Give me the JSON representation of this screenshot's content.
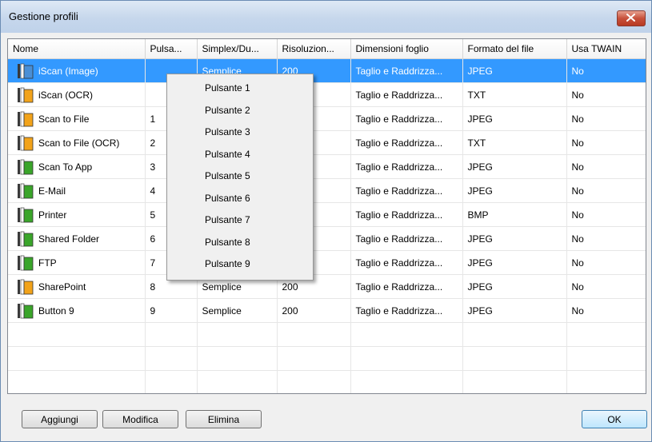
{
  "window": {
    "title": "Gestione profili"
  },
  "columns": [
    "Nome",
    "Pulsa...",
    "Simplex/Du...",
    "Risoluzion...",
    "Dimensioni foglio",
    "Formato del file",
    "Usa TWAIN"
  ],
  "rows": [
    {
      "icon": "blue",
      "name": "iScan (Image)",
      "button": "",
      "mode": "Semplice",
      "res": "200",
      "size": "Taglio e Raddrizza...",
      "format": "JPEG",
      "twain": "No",
      "selected": true
    },
    {
      "icon": "orange",
      "name": "iScan (OCR)",
      "button": "",
      "mode": "",
      "res": "",
      "size": "Taglio e Raddrizza...",
      "format": "TXT",
      "twain": "No"
    },
    {
      "icon": "orange",
      "name": "Scan to File",
      "button": "1",
      "mode": "",
      "res": "",
      "size": "Taglio e Raddrizza...",
      "format": "JPEG",
      "twain": "No"
    },
    {
      "icon": "orange",
      "name": "Scan to File (OCR)",
      "button": "2",
      "mode": "",
      "res": "",
      "size": "Taglio e Raddrizza...",
      "format": "TXT",
      "twain": "No"
    },
    {
      "icon": "green",
      "name": "Scan To App",
      "button": "3",
      "mode": "",
      "res": "",
      "size": "Taglio e Raddrizza...",
      "format": "JPEG",
      "twain": "No"
    },
    {
      "icon": "green",
      "name": "E-Mail",
      "button": "4",
      "mode": "",
      "res": "",
      "size": "Taglio e Raddrizza...",
      "format": "JPEG",
      "twain": "No"
    },
    {
      "icon": "green",
      "name": "Printer",
      "button": "5",
      "mode": "",
      "res": "",
      "size": "Taglio e Raddrizza...",
      "format": "BMP",
      "twain": "No"
    },
    {
      "icon": "green",
      "name": "Shared Folder",
      "button": "6",
      "mode": "",
      "res": "",
      "size": "Taglio e Raddrizza...",
      "format": "JPEG",
      "twain": "No"
    },
    {
      "icon": "green",
      "name": "FTP",
      "button": "7",
      "mode": "",
      "res": "",
      "size": "Taglio e Raddrizza...",
      "format": "JPEG",
      "twain": "No"
    },
    {
      "icon": "orange",
      "name": "SharePoint",
      "button": "8",
      "mode": "Semplice",
      "res": "200",
      "size": "Taglio e Raddrizza...",
      "format": "JPEG",
      "twain": "No"
    },
    {
      "icon": "green",
      "name": "Button 9",
      "button": "9",
      "mode": "Semplice",
      "res": "200",
      "size": "Taglio e Raddrizza...",
      "format": "JPEG",
      "twain": "No"
    }
  ],
  "empty_rows": 4,
  "context_menu": [
    "Pulsante 1",
    "Pulsante 2",
    "Pulsante 3",
    "Pulsante 4",
    "Pulsante 5",
    "Pulsante 6",
    "Pulsante 7",
    "Pulsante 8",
    "Pulsante 9"
  ],
  "buttons": {
    "add": "Aggiungi",
    "edit": "Modifica",
    "delete": "Elimina",
    "ok": "OK"
  },
  "colors": {
    "selection": "#3399ff",
    "icon_blue": "#4a8fd6",
    "icon_orange": "#f2a31a",
    "icon_green": "#3aa52a",
    "close_red": "#c7513b"
  }
}
